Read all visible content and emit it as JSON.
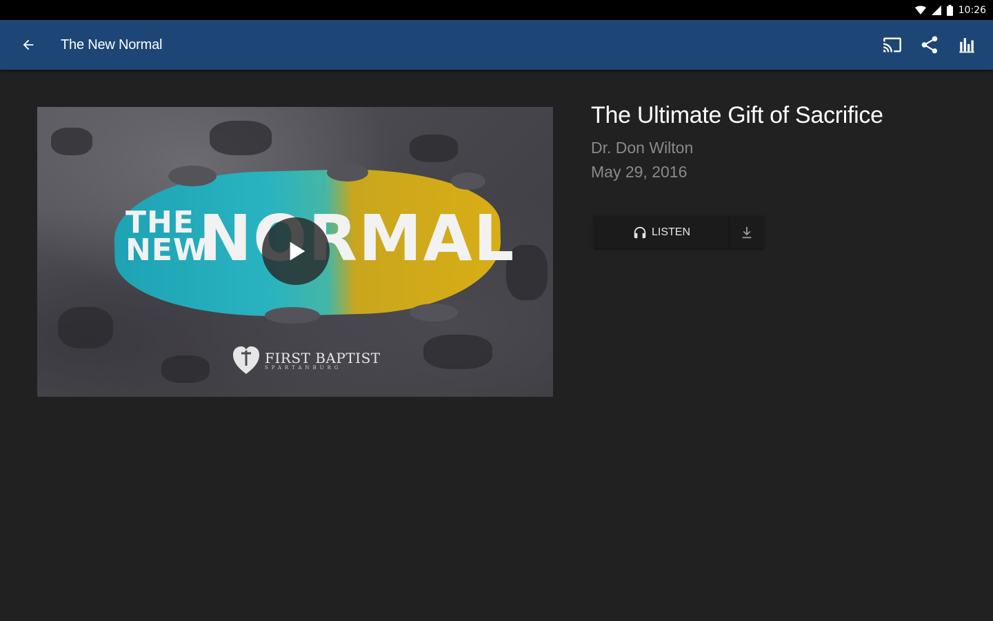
{
  "status_bar": {
    "time": "10:26"
  },
  "app_bar": {
    "title": "The New Normal",
    "actions": [
      "cast-icon",
      "share-icon",
      "chart-icon"
    ]
  },
  "media": {
    "thumbnail": {
      "art_title_line1": "THE",
      "art_title_line2": "NEW",
      "art_title_big": "NORMAL",
      "brand_name": "FIRST BAPTIST",
      "brand_sub": "SPARTANBURG"
    },
    "title": "The Ultimate Gift of Sacrifice",
    "speaker": "Dr. Don Wilton",
    "date": "May 29, 2016",
    "listen_label": "LISTEN"
  },
  "colors": {
    "app_bar": "#1d4677",
    "background": "#212121",
    "status_bar": "#000000"
  }
}
